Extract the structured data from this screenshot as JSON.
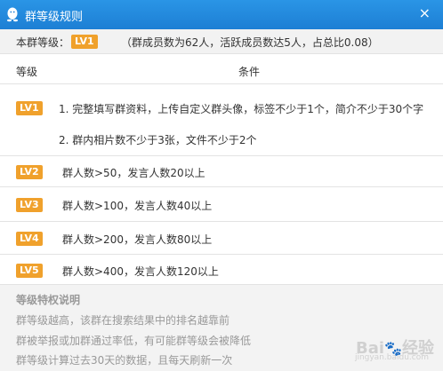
{
  "window": {
    "title": "群等级规则",
    "close_glyph": "×"
  },
  "summary": {
    "label": "本群等级：",
    "current_level": "LV1",
    "stats": "（群成员数为62人，活跃成员数达5人，占总比0.08）"
  },
  "table": {
    "header_level": "等级",
    "header_condition": "条件",
    "rows": [
      {
        "level": "LV1",
        "conditions": [
          "1. 完整填写群资料，上传自定义群头像，标签不少于1个，简介不少于30个字",
          "2. 群内相片数不少于3张，文件不少于2个"
        ]
      },
      {
        "level": "LV2",
        "conditions": [
          "群人数>50，发言人数20以上"
        ]
      },
      {
        "level": "LV3",
        "conditions": [
          "群人数>100，发言人数40以上"
        ]
      },
      {
        "level": "LV4",
        "conditions": [
          "群人数>200，发言人数80以上"
        ]
      },
      {
        "level": "LV5",
        "conditions": [
          "群人数>400，发言人数120以上"
        ]
      }
    ]
  },
  "footer": {
    "title": "等级特权说明",
    "lines": [
      "群等级越高，该群在搜索结果中的排名越靠前",
      "群被举报或加群通过率低，有可能群等级会被降低",
      "群等级计算过去30天的数据，且每天刷新一次"
    ]
  },
  "watermark": {
    "brand": "Bai",
    "brand_suffix": "经验",
    "sub": "jingyan.baidu.com"
  },
  "colors": {
    "titlebar": "#2a95e6",
    "badge": "#f0a12c"
  }
}
